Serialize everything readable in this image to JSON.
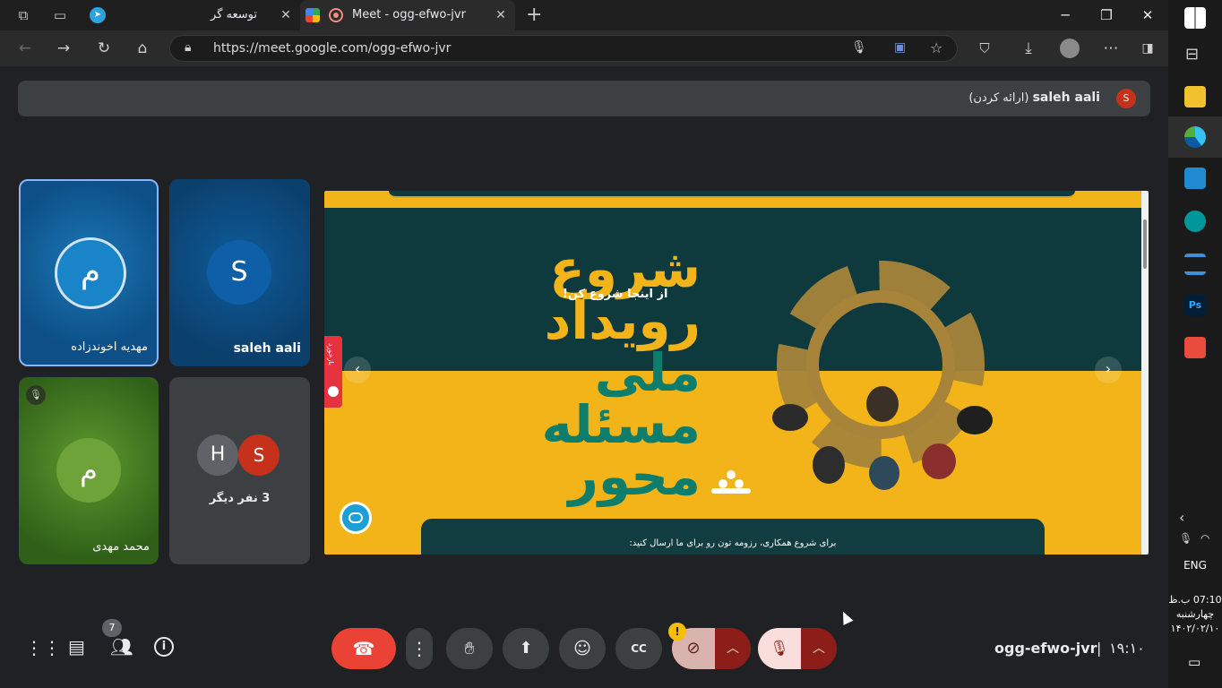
{
  "browser": {
    "tabs": [
      {
        "title": "توسعه گر",
        "active": false
      },
      {
        "title": "Meet - ogg-efwo-jvr",
        "active": true
      }
    ],
    "url": "https://meet.google.com/ogg-efwo-jvr"
  },
  "banner": {
    "avatar_letter": "S",
    "presenter_name": "saleh aali",
    "presenting_label": "(ارائه کردن)"
  },
  "participants": [
    {
      "name": "مهدیه اخوندزاده",
      "initial": "م",
      "speaking": true
    },
    {
      "name": "saleh aali",
      "initial": "S"
    },
    {
      "name": "محمد مهدی",
      "initial": "م",
      "muted": true
    },
    {
      "others_label": "3 نفر دیگر",
      "initials": [
        "H",
        "S"
      ]
    }
  ],
  "slide": {
    "headline_lines": [
      "شروع",
      "رویداد",
      "ملی",
      "مسئله",
      "محور"
    ],
    "subtitle": "از اینجا شروع کن!",
    "side_tab": "بازخورد",
    "bottom_text": "برای شروع همکاری، رزومه تون رو برای ما ارسال کنید:"
  },
  "controls": {
    "people_count": "7",
    "meeting_code": "ogg-efwo-jvr",
    "time": "۱۹:۱۰",
    "warning_badge": "!"
  },
  "taskbar": {
    "language": "ENG",
    "clock_time": "07:10 ب.ظ",
    "clock_day": "چهارشنبه",
    "clock_date": "۱۴۰۲/۰۲/۱۰"
  },
  "colors": {
    "meet_bg": "#202124",
    "hangup": "#ea4335",
    "camera_off": "#d9b3ad",
    "mic_off": "#f9dedc",
    "slide_yellow": "#f2b418",
    "slide_teal": "#0f3a3d"
  }
}
